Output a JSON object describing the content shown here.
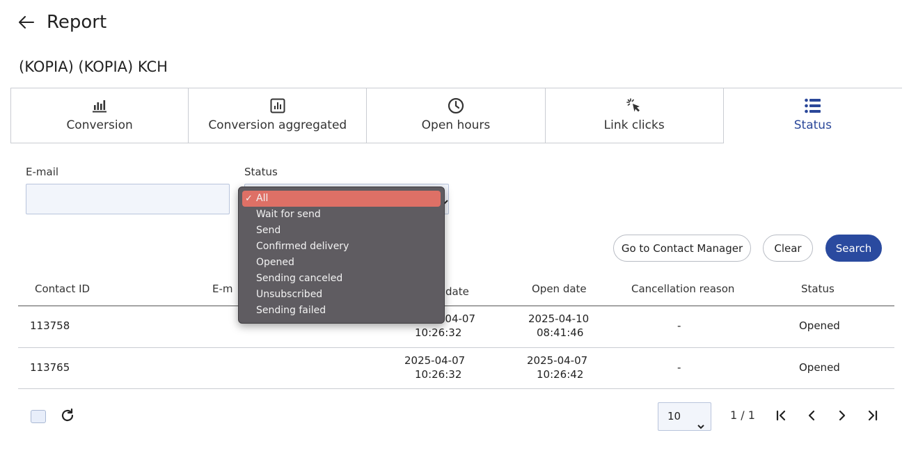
{
  "header": {
    "title": "Report"
  },
  "campaign": {
    "name": "(KOPIA) (KOPIA) KCH"
  },
  "tabs": [
    {
      "label": "Conversion",
      "icon": "bar-chart-icon"
    },
    {
      "label": "Conversion aggregated",
      "icon": "chart-box-icon"
    },
    {
      "label": "Open hours",
      "icon": "clock-icon"
    },
    {
      "label": "Link clicks",
      "icon": "cursor-click-icon"
    },
    {
      "label": "Status",
      "icon": "list-icon",
      "active": true
    }
  ],
  "filters": {
    "email_label": "E-mail",
    "email_value": "",
    "status_label": "Status",
    "status_value": "All",
    "status_options": [
      "All",
      "Wait for send",
      "Send",
      "Confirmed delivery",
      "Opened",
      "Sending canceled",
      "Unsubscribed",
      "Sending failed"
    ],
    "selected_check": "✓"
  },
  "actions": {
    "contact_manager": "Go to Contact Manager",
    "clear": "Clear",
    "search": "Search"
  },
  "table": {
    "columns": [
      "Contact ID",
      "E-m",
      "date",
      "Open date",
      "Cancellation reason",
      "Status"
    ],
    "rows": [
      {
        "contact_id": "113758",
        "send_date_1": "-04-07",
        "send_date_2": "10:26:32",
        "open_date_1": "2025-04-10",
        "open_date_2": "08:41:46",
        "reason": "-",
        "status": "Opened"
      },
      {
        "contact_id": "113765",
        "send_date_1": "2025-04-07",
        "send_date_2": "10:26:32",
        "open_date_1": "2025-04-07",
        "open_date_2": "10:26:42",
        "reason": "-",
        "status": "Opened"
      }
    ]
  },
  "pagination": {
    "page_size": "10",
    "page_info": "1 / 1"
  },
  "colors": {
    "accent": "#2a4a9f",
    "selected_option": "#de7066",
    "dropdown_bg": "#5f5c61"
  }
}
